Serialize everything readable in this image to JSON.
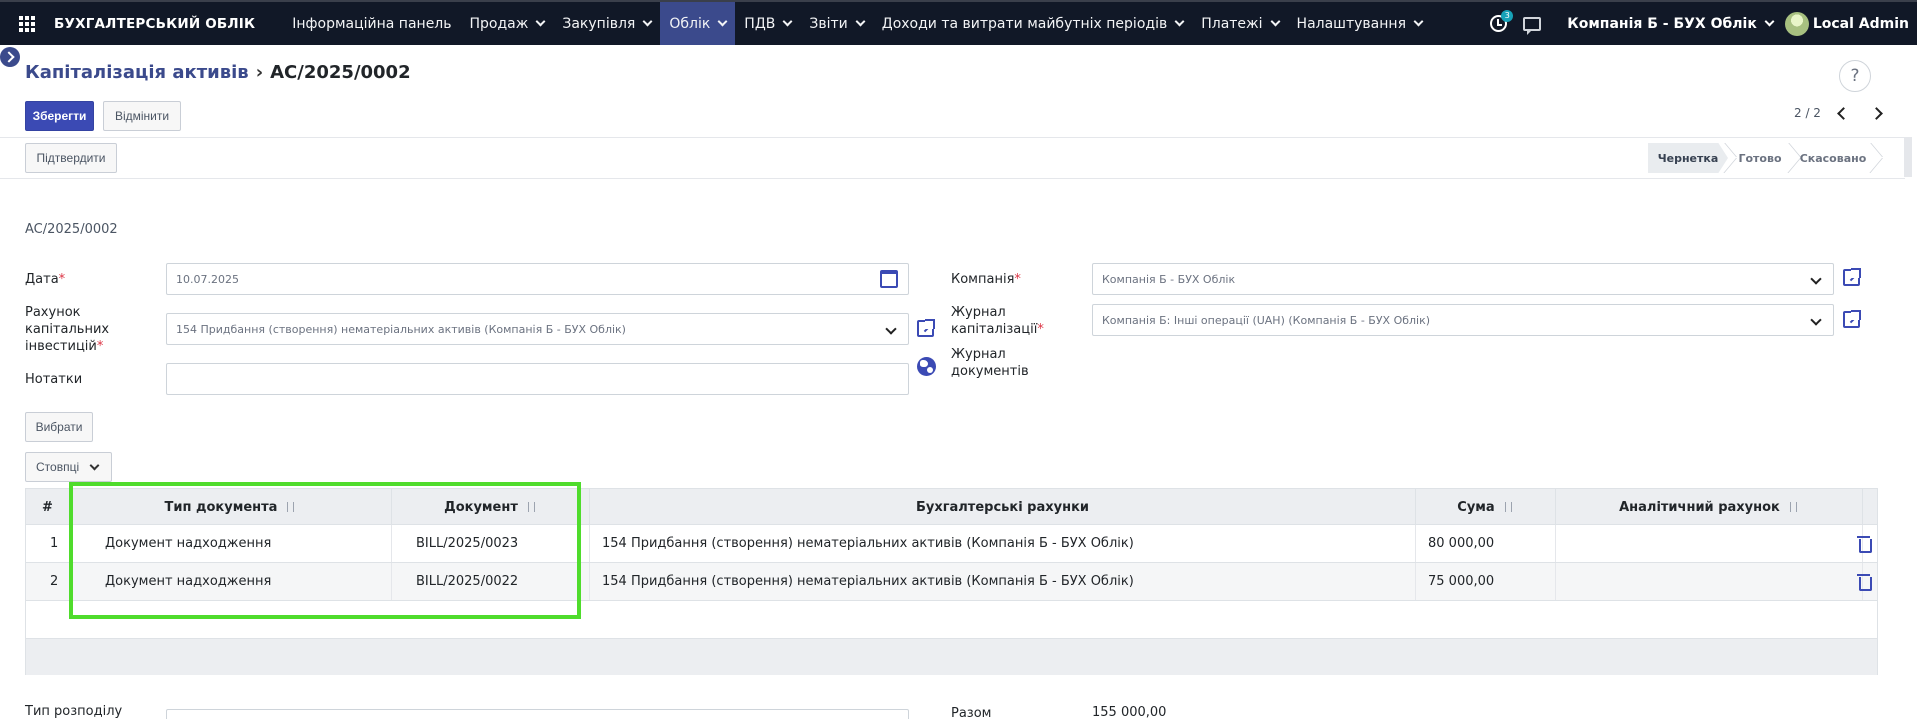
{
  "navbar": {
    "brand": "БУХГАЛТЕРСЬКИЙ ОБЛІК",
    "menu": [
      {
        "label": "Інформаційна панель",
        "dropdown": false,
        "active": false
      },
      {
        "label": "Продаж",
        "dropdown": true,
        "active": false
      },
      {
        "label": "Закупівля",
        "dropdown": true,
        "active": false
      },
      {
        "label": "Облік",
        "dropdown": true,
        "active": true
      },
      {
        "label": "ПДВ",
        "dropdown": true,
        "active": false
      },
      {
        "label": "Звіти",
        "dropdown": true,
        "active": false
      },
      {
        "label": "Доходи та витрати майбутніх періодів",
        "dropdown": true,
        "active": false
      },
      {
        "label": "Платежі",
        "dropdown": true,
        "active": false
      },
      {
        "label": "Налаштування",
        "dropdown": true,
        "active": false
      }
    ],
    "activity_count": "3",
    "company": "Компанія Б - БУХ Облік",
    "user": "Local Admin"
  },
  "breadcrumb": {
    "parent": "Капіталізація активів",
    "current": "AC/2025/0002"
  },
  "help_label": "?",
  "buttons": {
    "save": "Зберегти",
    "discard": "Відмінити",
    "confirm": "Підтвердити",
    "select": "Вибрати",
    "columns": "Стовпці"
  },
  "pager": {
    "value": "2 / 2"
  },
  "statusbar": {
    "draft": "Чернетка",
    "done": "Готово",
    "cancelled": "Скасовано",
    "current": "draft"
  },
  "form": {
    "name": "AC/2025/0002",
    "date": {
      "label": "Дата",
      "value": "10.07.2025"
    },
    "account": {
      "label_lines": [
        "Рахунок",
        "капітальних",
        "інвестицій"
      ],
      "value": "154 Придбання (створення) нематеріальних активів (Компанія Б - БУХ Облік)"
    },
    "notes": {
      "label": "Нотатки",
      "value": ""
    },
    "company": {
      "label": "Компанія",
      "value": "Компанія Б - БУХ Облік"
    },
    "journal": {
      "label_lines": [
        "Журнал",
        "капіталізації"
      ],
      "value": "Компанія Б: Інші операції (UAH) (Компанія Б - БУХ Облік)"
    },
    "doc_journal": {
      "label_lines": [
        "Журнал",
        "документів"
      ]
    },
    "distribution_type": {
      "label": "Тип розподілу"
    },
    "total": {
      "label": "Разом",
      "value": "155 000,00"
    }
  },
  "table": {
    "columns": [
      {
        "key": "num",
        "label": "#",
        "sortable": false
      },
      {
        "key": "doc_type",
        "label": "Тип документа",
        "sortable": true
      },
      {
        "key": "document",
        "label": "Документ",
        "sortable": true
      },
      {
        "key": "accounts",
        "label": "Бухгалтерські рахунки",
        "sortable": false
      },
      {
        "key": "amount",
        "label": "Сума",
        "sortable": true
      },
      {
        "key": "analytic",
        "label": "Аналітичний рахунок",
        "sortable": true
      }
    ],
    "rows": [
      {
        "num": "1",
        "doc_type": "Документ надходження",
        "document": "BILL/2025/0023",
        "accounts": "154 Придбання (створення) нематеріальних активів (Компанія Б - БУХ Облік)",
        "amount": "80 000,00",
        "analytic": ""
      },
      {
        "num": "2",
        "doc_type": "Документ надходження",
        "document": "BILL/2025/0022",
        "accounts": "154 Придбання (створення) нематеріальних активів (Компанія Б - БУХ Облік)",
        "amount": "75 000,00",
        "analytic": ""
      }
    ]
  },
  "colors": {
    "navbar_bg": "#111827",
    "active_menu": "#3b4a8c",
    "primary": "#3b4ab4",
    "highlight": "#4fdc2c"
  }
}
